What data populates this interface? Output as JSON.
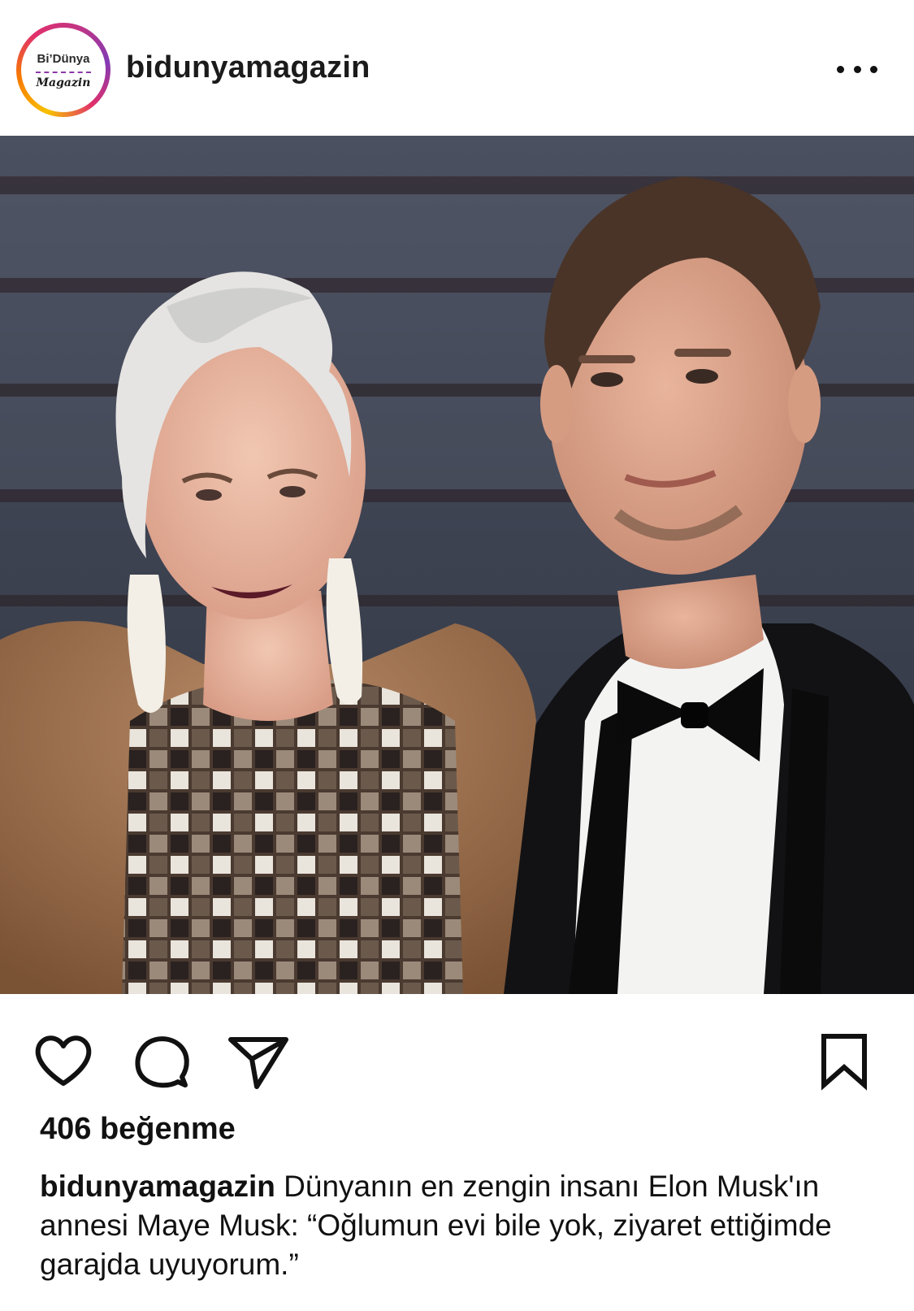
{
  "header": {
    "avatar_text_top": "Bi’Dünya",
    "avatar_text_bottom": "Magazin",
    "username": "bidunyamagazin",
    "more_icon": "more-horizontal-icon"
  },
  "post": {
    "image_icon": "photo",
    "actions": {
      "like_icon": "heart-icon",
      "comment_icon": "comment-icon",
      "share_icon": "send-icon",
      "save_icon": "bookmark-icon"
    },
    "likes_text": "406 beğenme",
    "caption": {
      "username": "bidunyamagazin",
      "text": "Dünyanın en zengin insanı Elon Musk'ın annesi Maye Musk: “Oğlumun evi bile yok, ziyaret ettiğimde garajda uyuyorum.”"
    }
  },
  "colors": {
    "story_ring": [
      "#f7c100",
      "#e1306c",
      "#833ab4"
    ],
    "text": "#111111"
  }
}
